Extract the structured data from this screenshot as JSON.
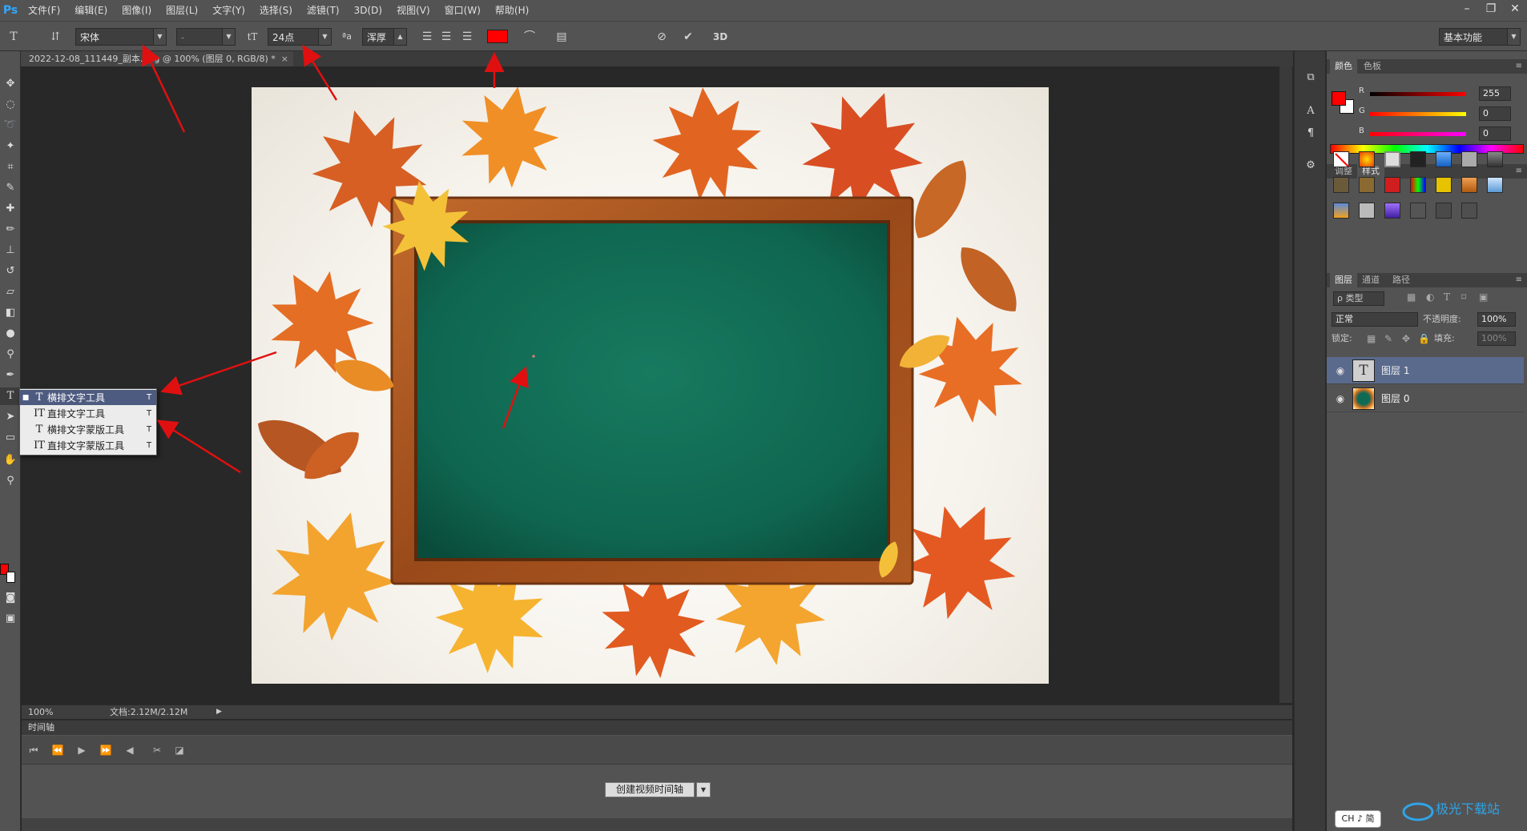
{
  "app": {
    "logo": "Ps"
  },
  "menu": [
    "文件(F)",
    "编辑(E)",
    "图像(I)",
    "图层(L)",
    "文字(Y)",
    "选择(S)",
    "滤镜(T)",
    "3D(D)",
    "视图(V)",
    "窗口(W)",
    "帮助(H)"
  ],
  "window_controls": {
    "minimize": "–",
    "restore": "❐",
    "close": "✕"
  },
  "options": {
    "font_family": "宋体",
    "font_style": "-",
    "font_size": "24点",
    "aa_label": "ªa",
    "anti_alias": "浑厚",
    "text_color": "#ff0000",
    "threed": "3D",
    "workspace": "基本功能"
  },
  "document": {
    "tab_title": "2022-12-08_111449_副本.png @ 100% (图层 0, RGB/8) *",
    "tab_close": "×"
  },
  "flyout": {
    "items": [
      {
        "label": "横排文字工具",
        "shortcut": "T",
        "icon": "horizontal-type-icon",
        "glyph": "T",
        "active": true
      },
      {
        "label": "直排文字工具",
        "shortcut": "T",
        "icon": "vertical-type-icon",
        "glyph": "IT",
        "active": false
      },
      {
        "label": "横排文字蒙版工具",
        "shortcut": "T",
        "icon": "horizontal-type-mask-icon",
        "glyph": "T",
        "active": false
      },
      {
        "label": "直排文字蒙版工具",
        "shortcut": "T",
        "icon": "vertical-type-mask-icon",
        "glyph": "IT",
        "active": false
      }
    ]
  },
  "status": {
    "zoom": "100%",
    "doc_size": "文档:2.12M/2.12M"
  },
  "timeline": {
    "title": "时间轴",
    "create_button": "创建视频时间轴"
  },
  "panels": {
    "color_tabs": [
      "颜色",
      "色板"
    ],
    "color": {
      "r_label": "R",
      "g_label": "G",
      "b_label": "B",
      "r": "255",
      "g": "0",
      "b": "0",
      "foreground": "#ff0000",
      "background": "#ffffff"
    },
    "style_tabs": [
      "调整",
      "样式"
    ],
    "layer_tabs": [
      "图层",
      "通道",
      "路径"
    ],
    "layers": {
      "filter": "ρ 类型",
      "blend_mode": "正常",
      "opacity_label": "不透明度:",
      "opacity": "100%",
      "lock_label": "锁定:",
      "fill_label": "填充:",
      "fill": "100%",
      "items": [
        {
          "name": "图层 1",
          "type": "text",
          "selected": true
        },
        {
          "name": "图层 0",
          "type": "image",
          "selected": false
        }
      ]
    }
  },
  "ime": "CH ♪ 简",
  "watermark": "极光下载站"
}
